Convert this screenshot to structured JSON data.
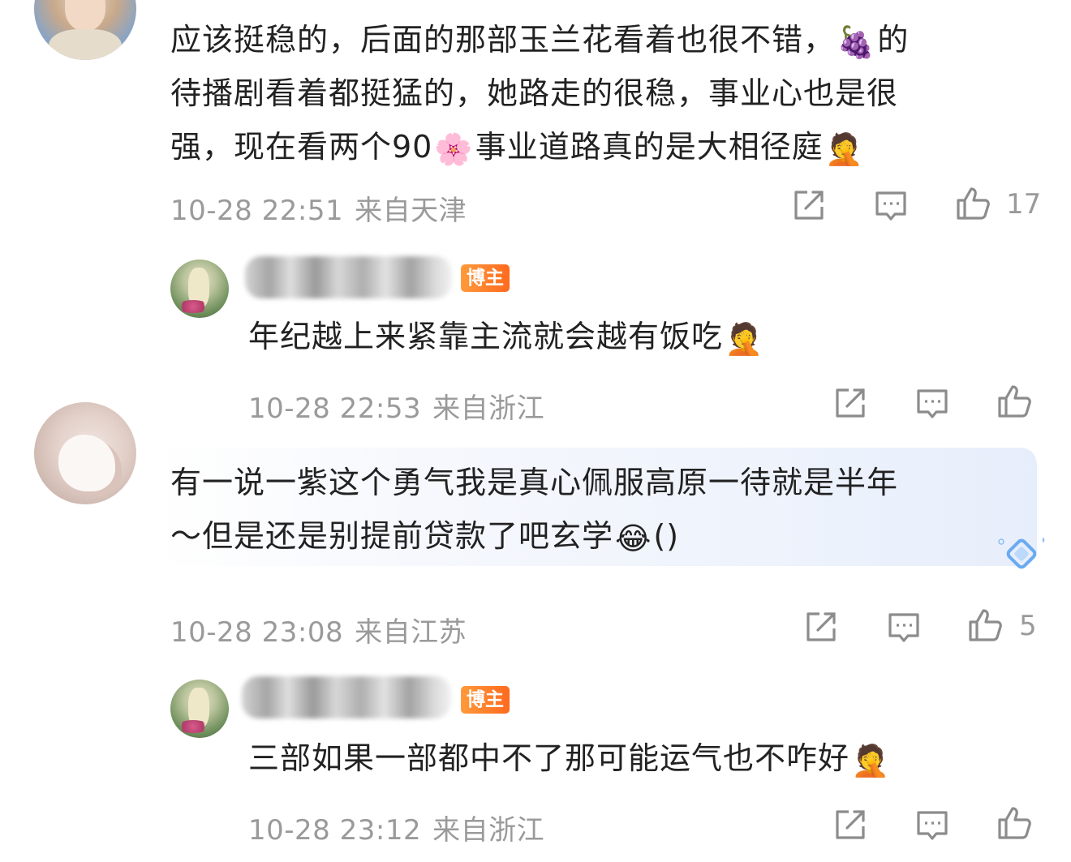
{
  "comments": [
    {
      "lines": [
        "应该挺稳的，后面的那部玉兰花看着也很不错，",
        "待播剧看着都挺猛的，她路走的很稳，事业心也是很",
        "强，现在看两个90",
        "事业道路真的是大相径庭"
      ],
      "line1_tail": "的",
      "date": "10-28 22:51",
      "location": "来自天津",
      "likes": "17"
    },
    {
      "badge": "博主",
      "text": "年纪越上来紧靠主流就会越有饭吃",
      "date": "10-28 22:53",
      "location": "来自浙江",
      "likes": ""
    },
    {
      "lines": [
        "有一说一紫这个勇气我是真心佩服高原一待就是半年",
        "～但是还是别提前贷款了吧玄学"
      ],
      "line2_tail": "()",
      "date": "10-28 23:08",
      "location": "来自江苏",
      "likes": "5"
    },
    {
      "badge": "博主",
      "text": "三部如果一部都中不了那可能运气也不咋好",
      "date": "10-28 23:12",
      "location": "来自浙江",
      "likes": ""
    }
  ],
  "emojis": {
    "grape": "🍇",
    "blossom": "🌸",
    "facepalm": "🤦",
    "laugh_cry": "😂"
  },
  "icons": [
    "share-icon",
    "comment-icon",
    "like-icon"
  ]
}
